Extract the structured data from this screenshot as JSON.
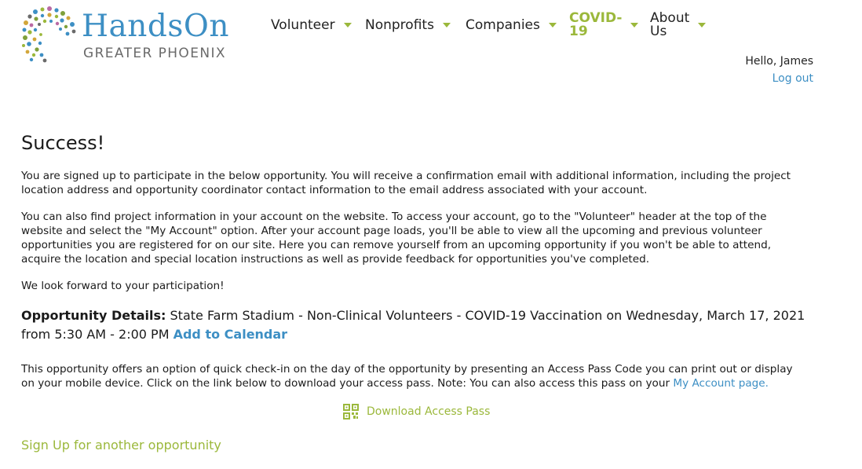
{
  "brand": {
    "title": "HandsOn",
    "subtitle": "GREATER PHOENIX"
  },
  "nav": {
    "items": [
      {
        "label": "Volunteer"
      },
      {
        "label": "Nonprofits"
      },
      {
        "label": "Companies"
      },
      {
        "label": "COVID-\n19"
      },
      {
        "label": "About\nUs"
      }
    ]
  },
  "user": {
    "greeting": "Hello, James",
    "logout": "Log out"
  },
  "content": {
    "heading": "Success!",
    "para1": "You are signed up to participate in the below opportunity. You will receive a confirmation email with additional information, including the project location address and opportunity coordinator contact information to the email address associated with your account.",
    "para2": "You can also find project information in your account on the website. To access your account, go to the \"Volunteer\" header at the top of the website and select the \"My Account\" option. After your account page loads, you'll be able to view all the upcoming and previous volunteer opportunities you are registered for on our site. Here you can remove yourself from an upcoming opportunity if you won't be able to attend, acquire the location and special location instructions as well as provide feedback for opportunities you've completed.",
    "para3": "We look forward to your participation!",
    "details_label": "Opportunity Details:",
    "details_text": " State Farm Stadium - Non-Clinical Volunteers - COVID-19 Vaccination on Wednesday, March 17, 2021 from 5:30 AM - 2:00 PM ",
    "add_to_calendar": "Add to Calendar",
    "access_text": "This opportunity offers an option of quick check-in on the day of the opportunity by presenting an Access Pass Code you can print out or display on your mobile device. Click on the link below to download your access pass. Note: You can also access this pass on your ",
    "my_account_link": "My Account page.",
    "download_label": "Download Access Pass",
    "signup_label": "Sign Up for another opportunity"
  },
  "colors": {
    "accent_blue": "#3d8fc4",
    "accent_green": "#9bb83b"
  },
  "icons": {
    "download": "qr-code-icon",
    "nav_caret": "caret-down-icon"
  }
}
